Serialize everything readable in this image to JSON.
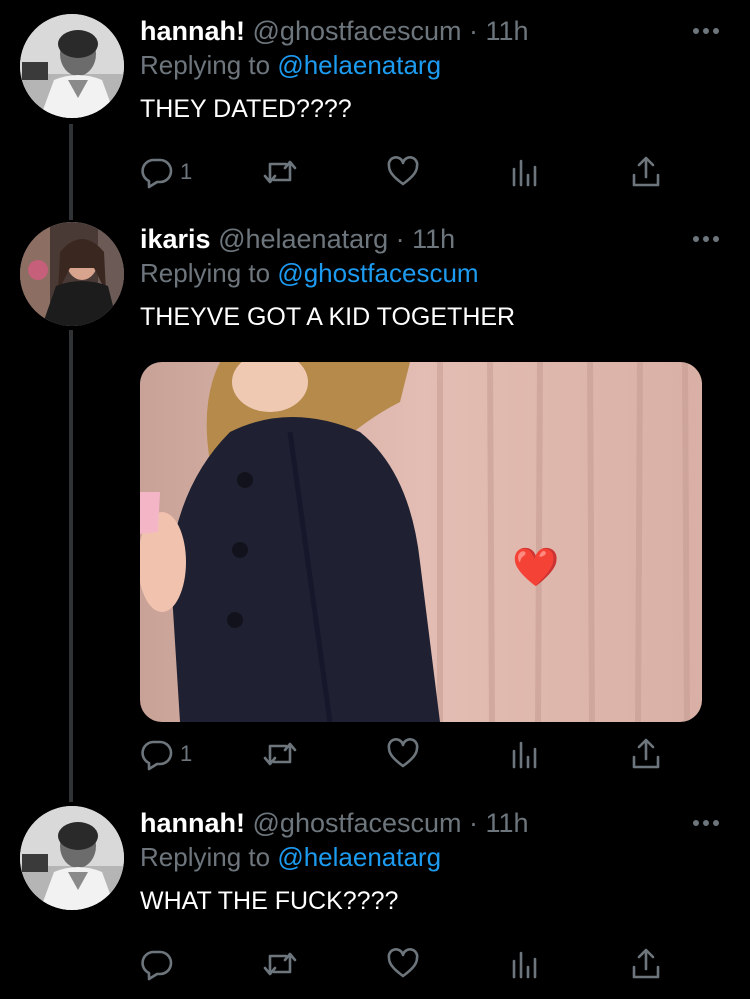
{
  "tweets": [
    {
      "name": "hannah!",
      "handle": "@ghostfacescum",
      "time": "· 11h",
      "replying_prefix": "Replying to",
      "replying_to": "@helaenatarg",
      "text": "THEY DATED????",
      "reply_count": "1"
    },
    {
      "name": "ikaris",
      "handle": "@helaenatarg",
      "time": "· 11h",
      "replying_prefix": "Replying to",
      "replying_to": "@ghostfacescum",
      "text": "THEYVE GOT A KID TOGETHER",
      "reply_count": "1",
      "media_emoji": "❤️"
    },
    {
      "name": "hannah!",
      "handle": "@ghostfacescum",
      "time": "· 11h",
      "replying_prefix": "Replying to",
      "replying_to": "@helaenatarg",
      "text": "WHAT THE FUCK????",
      "reply_count": ""
    }
  ],
  "colors": {
    "background": "#000000",
    "secondary_text": "#6e767d",
    "link": "#1d9bf0",
    "heart_emoji": "#e5262a"
  },
  "icons": [
    "reply-icon",
    "retweet-icon",
    "like-icon",
    "analytics-icon",
    "share-icon",
    "more-icon"
  ]
}
